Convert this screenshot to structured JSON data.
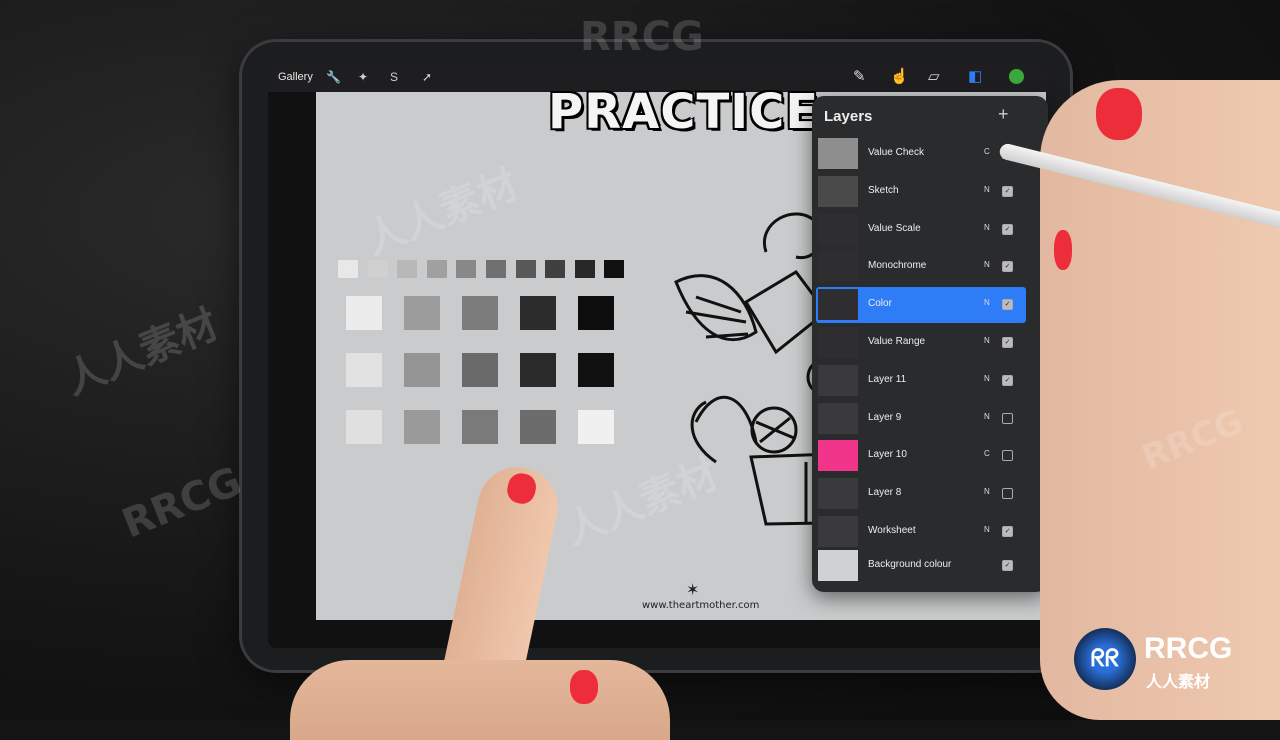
{
  "app": {
    "gallery_label": "Gallery",
    "toolbar_left_icons": [
      "wrench-icon",
      "magic-wand-icon",
      "selection-icon",
      "transform-arrow-icon"
    ],
    "toolbar_right_icons": [
      "brush-icon",
      "smudge-icon",
      "eraser-icon",
      "layers-icon"
    ],
    "active_color": "#3aa83a"
  },
  "canvas": {
    "title_art": "PRACTICE",
    "footer_url": "www.theartmother.com",
    "value_scale_colors": [
      "#e8e8e8",
      "#d0d0d0",
      "#b8b8b8",
      "#a0a0a0",
      "#888888",
      "#707070",
      "#585858",
      "#404040",
      "#282828",
      "#101010"
    ],
    "swatch_grid": [
      [
        "#ececec",
        "#9c9c9c",
        "#7c7c7c",
        "#2c2c2c",
        "#0e0e0e"
      ],
      [
        "#e2e2e2",
        "#949494",
        "#6a6a6a",
        "#2a2a2a",
        "#101010"
      ],
      [
        "#e0e0e0",
        "#9a9a9a",
        "#7a7a7a",
        "#6c6c6c",
        "#f0f0f0"
      ]
    ]
  },
  "layers_panel": {
    "title": "Layers",
    "add_label": "+",
    "selected_color": "#2e7cf6",
    "items": [
      {
        "name": "Value Check",
        "mode": "C",
        "visible": true
      },
      {
        "name": "Sketch",
        "mode": "N",
        "visible": true
      },
      {
        "name": "Value Scale",
        "mode": "N",
        "visible": true
      },
      {
        "name": "Monochrome",
        "mode": "N",
        "visible": true
      },
      {
        "name": "Color",
        "mode": "N",
        "visible": true,
        "selected": true
      },
      {
        "name": "Value Range",
        "mode": "N",
        "visible": true
      },
      {
        "name": "Layer 11",
        "mode": "N",
        "visible": true
      },
      {
        "name": "Layer 9",
        "mode": "N",
        "visible": false
      },
      {
        "name": "Layer 10",
        "mode": "C",
        "visible": false
      },
      {
        "name": "Layer 8",
        "mode": "N",
        "visible": false
      },
      {
        "name": "Worksheet",
        "mode": "N",
        "visible": true
      },
      {
        "name": "Background colour",
        "mode": "",
        "visible": true
      }
    ]
  },
  "watermark": {
    "main": "RRCG",
    "sub": "人人素材"
  }
}
